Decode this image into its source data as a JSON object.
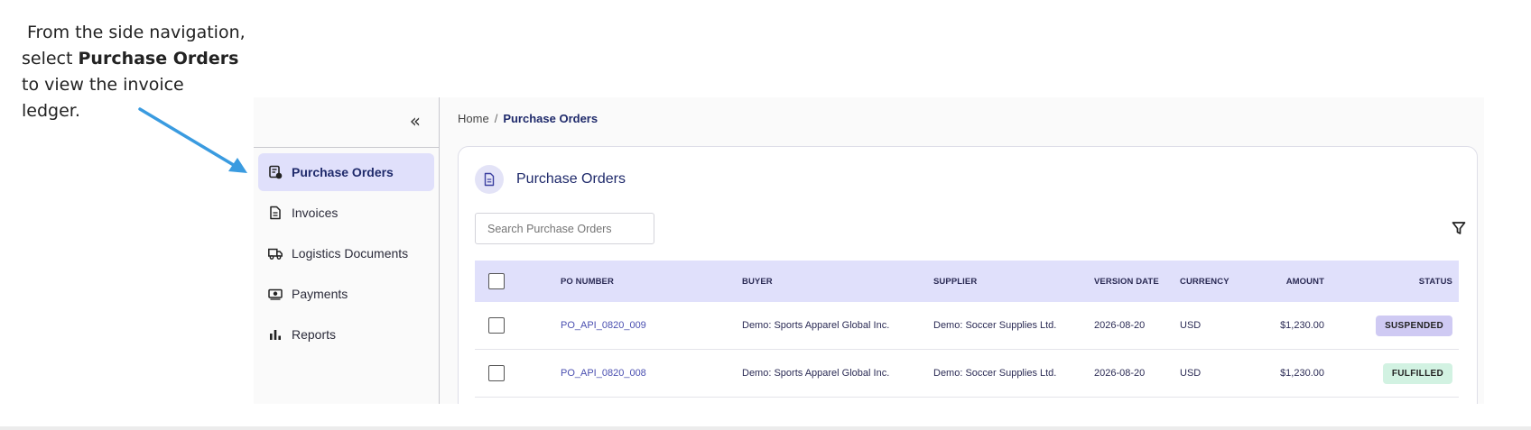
{
  "callout": {
    "line1": "From the side navigation,",
    "line2_prefix": "select ",
    "line2_bold": "Purchase Orders",
    "line3": "to view the invoice ledger."
  },
  "sidebar": {
    "collapse_glyph": "«",
    "items": [
      {
        "label": "Purchase Orders",
        "icon": "purchase-order-icon",
        "active": true
      },
      {
        "label": "Invoices",
        "icon": "document-icon",
        "active": false
      },
      {
        "label": "Logistics Documents",
        "icon": "truck-icon",
        "active": false
      },
      {
        "label": "Payments",
        "icon": "money-icon",
        "active": false
      },
      {
        "label": "Reports",
        "icon": "bar-chart-icon",
        "active": false
      }
    ]
  },
  "breadcrumb": {
    "home": "Home",
    "separator": "/",
    "current": "Purchase Orders"
  },
  "card": {
    "title": "Purchase Orders",
    "icon": "document-icon"
  },
  "search": {
    "placeholder": "Search Purchase Orders",
    "value": ""
  },
  "table": {
    "columns": [
      "PO NUMBER",
      "BUYER",
      "SUPPLIER",
      "VERSION DATE",
      "CURRENCY",
      "AMOUNT",
      "STATUS"
    ],
    "rows": [
      {
        "po": "PO_API_0820_009",
        "buyer": "Demo: Sports Apparel Global Inc.",
        "supplier": "Demo: Soccer Supplies Ltd.",
        "date": "2026-08-20",
        "currency": "USD",
        "amount": "$1,230.00",
        "status": "SUSPENDED"
      },
      {
        "po": "PO_API_0820_008",
        "buyer": "Demo: Sports Apparel Global Inc.",
        "supplier": "Demo: Soccer Supplies Ltd.",
        "date": "2026-08-20",
        "currency": "USD",
        "amount": "$1,230.00",
        "status": "FULFILLED"
      }
    ]
  },
  "colors": {
    "accent": "#e0e0fb",
    "accent_text": "#1f2a6b",
    "arrow": "#3a9be0",
    "suspended_bg": "#cfcaf3",
    "fulfilled_bg": "#d2f2e2"
  }
}
